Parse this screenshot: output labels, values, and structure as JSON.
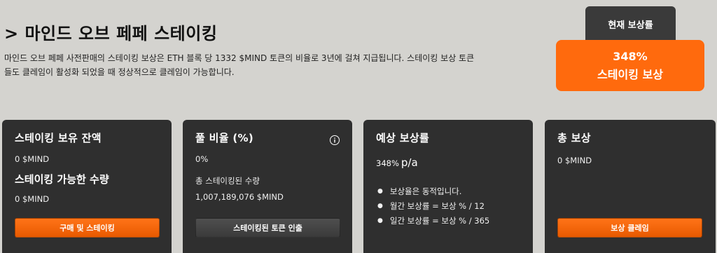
{
  "header": {
    "title": "> 마인드 오브 페페 스테이킹",
    "description": "마인드 오브 페페 사전판매의 스테이킹 보상은 ETH 블록 당 1332 $MIND 토큰의 비율로 3년에 걸쳐 지급됩니다. 스테이킹 보상 토큰들도 클레임이 활성화 되었을 때 정상적으로 클레임이 가능합니다."
  },
  "current_rate": {
    "tab_label": "현재 보상률",
    "percent": "348%",
    "label": "스테이킹 보상"
  },
  "cards": {
    "balance": {
      "title": "스테이킹 보유 잔액",
      "value": "0 $MIND",
      "subtitle": "스테이킹 가능한 수량",
      "sub_value": "0 $MIND",
      "button": "구매 및 스테이킹"
    },
    "pool": {
      "title": "풀 비율 (%)",
      "value": "0%",
      "label": "총 스테이킹된 수량",
      "total": "1,007,189,076 $MIND",
      "button": "스테이킹된 토큰 인출",
      "info_icon": "info-icon"
    },
    "expected": {
      "title": "예상 보상률",
      "rate": "348%",
      "unit": "p/a",
      "bullets": [
        "보상율은 동적입니다.",
        "월간 보상률 = 보상 % / 12",
        "일간 보상률 = 보상 % / 365"
      ]
    },
    "total": {
      "title": "총 보상",
      "value": "0 $MIND",
      "button": "보상 클레임"
    }
  },
  "colors": {
    "accent": "#ff6a0d",
    "card_bg": "#2f2f2f",
    "page_bg": "#d4d3cf"
  }
}
